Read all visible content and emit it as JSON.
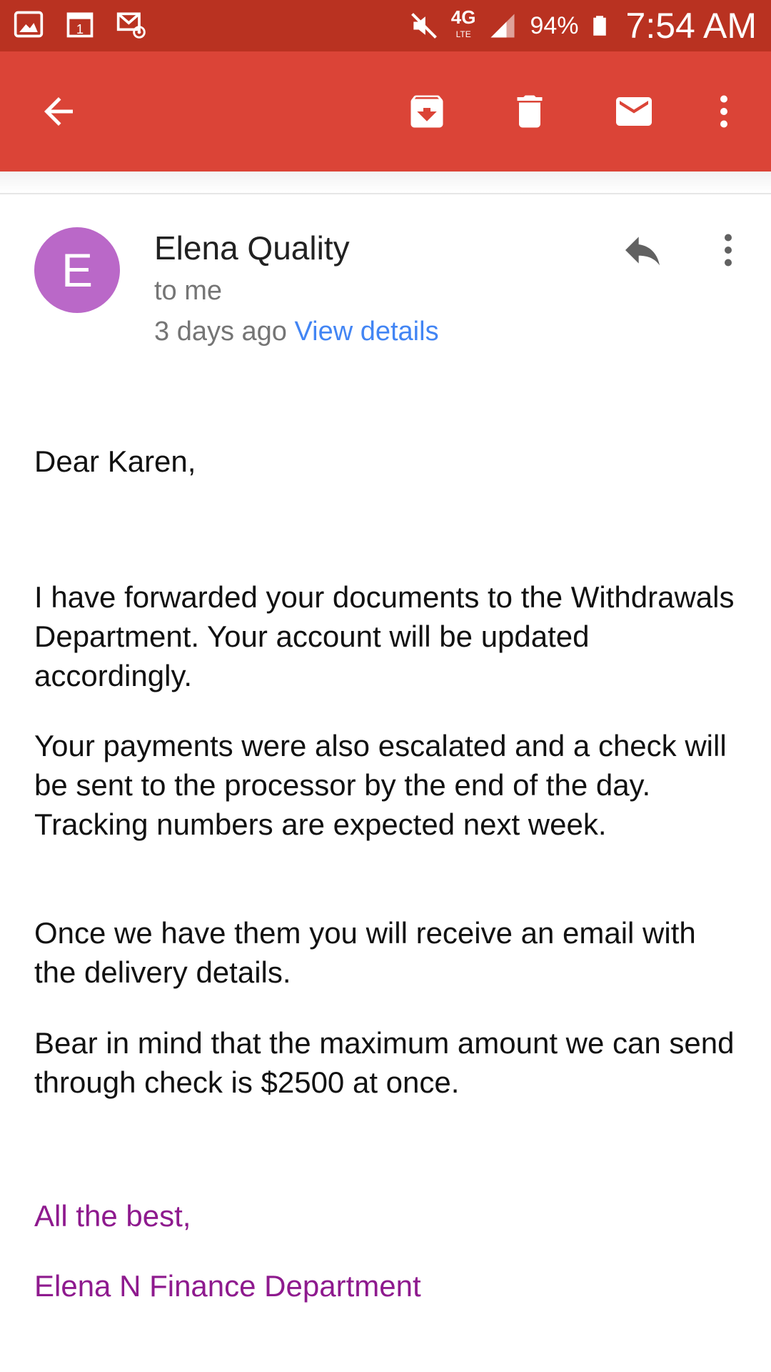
{
  "status_bar": {
    "battery_percent": "94%",
    "time": "7:54 AM",
    "network": "4G",
    "network_sub": "LTE",
    "icons": [
      "gallery-icon",
      "calendar-icon",
      "email-notification-icon",
      "mute-icon",
      "signal-icon",
      "battery-icon"
    ],
    "calendar_day": "1"
  },
  "toolbar": {
    "icons": [
      "back-arrow-icon",
      "archive-icon",
      "delete-icon",
      "mark-unread-icon",
      "more-vert-icon"
    ]
  },
  "message": {
    "avatar_letter": "E",
    "avatar_color": "#ba68c8",
    "sender": "Elena Quality",
    "recipient": "to me",
    "date": "3 days ago",
    "view_details": "View details",
    "greeting": "Dear Karen,",
    "paragraphs": [
      "I have forwarded your documents to the Withdrawals Department. Your account will be updated accordingly.",
      "Your payments were also escalated and a check will be sent to the processor by the end of the day. Tracking numbers are expected next week.",
      "Once we have them you will receive an email with the delivery details.",
      "Bear in mind that the maximum amount we can send through check is $2500 at once."
    ],
    "signoff": "All the best,",
    "signature": "Elena N Finance Department"
  },
  "colors": {
    "status_bar": "#b93221",
    "app_bar": "#db4437",
    "link": "#4285f4",
    "signature": "#8e1a8e"
  }
}
